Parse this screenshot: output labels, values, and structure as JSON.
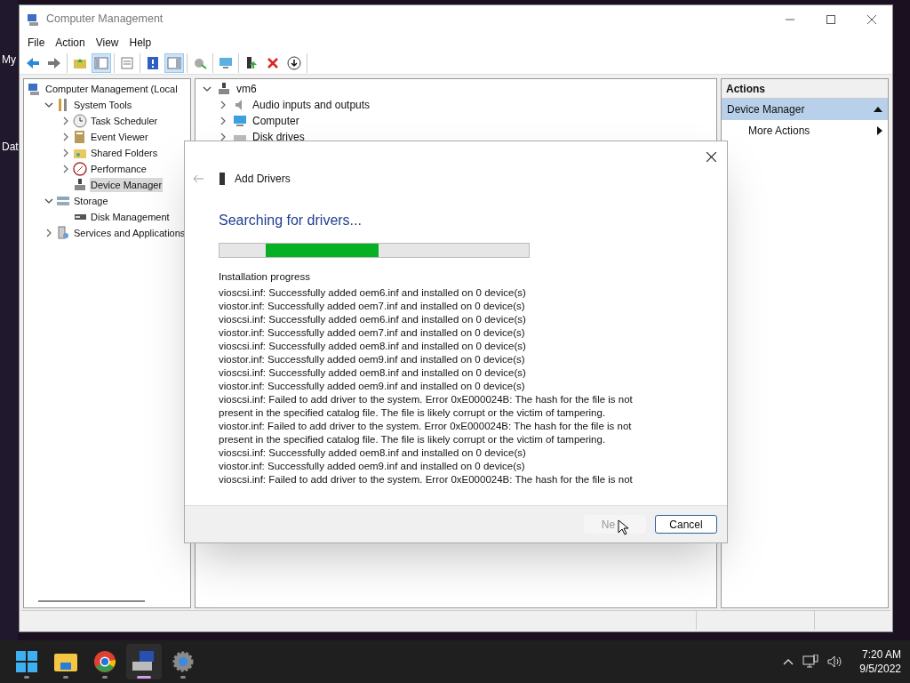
{
  "desktop_labels": [
    "My",
    "Dat"
  ],
  "window": {
    "title": "Computer Management"
  },
  "menu": [
    "File",
    "Action",
    "View",
    "Help"
  ],
  "toolbar": [
    {
      "pressed": false
    },
    {
      "pressed": false
    },
    {
      "pressed": false
    },
    {
      "pressed": true
    },
    {
      "pressed": false
    },
    {
      "pressed": false
    },
    {
      "pressed": true
    },
    {
      "pressed": false
    },
    {
      "pressed": false
    },
    {
      "pressed": false
    },
    {
      "pressed": false
    },
    {
      "pressed": false
    }
  ],
  "tree": [
    {
      "label": "Computer Management (Local",
      "kind": "root",
      "selected": false,
      "children": [
        {
          "label": "System Tools",
          "kind": "node",
          "expanded": true,
          "selected": false,
          "children": [
            {
              "label": "Task Scheduler",
              "kind": "node",
              "expanded": false,
              "selected": false
            },
            {
              "label": "Event Viewer",
              "kind": "node",
              "expanded": false,
              "selected": false
            },
            {
              "label": "Shared Folders",
              "kind": "node",
              "expanded": false,
              "selected": false
            },
            {
              "label": "Performance",
              "kind": "node",
              "expanded": false,
              "selected": false
            },
            {
              "label": "Device Manager",
              "kind": "leaf",
              "selected": true
            }
          ]
        },
        {
          "label": "Storage",
          "kind": "node",
          "expanded": true,
          "selected": false,
          "children": [
            {
              "label": "Disk Management",
              "kind": "leaf",
              "selected": false
            }
          ]
        },
        {
          "label": "Services and Applications",
          "kind": "node",
          "expanded": false,
          "selected": false
        }
      ]
    }
  ],
  "devices": [
    {
      "label": "vm6",
      "kind": "node",
      "expanded": true,
      "children": [
        {
          "label": "Audio inputs and outputs",
          "kind": "node",
          "expanded": false
        },
        {
          "label": "Computer",
          "kind": "node",
          "expanded": false
        },
        {
          "label": "Disk drives",
          "kind": "node",
          "expanded": false
        }
      ]
    }
  ],
  "actions": {
    "title": "Actions",
    "section": "Device Manager",
    "items": [
      "More Actions"
    ]
  },
  "dialog": {
    "title": "Add Drivers",
    "heading": "Searching for drivers...",
    "progress": {
      "indeterminate": true
    },
    "log_label": "Installation progress",
    "log_lines": [
      "vioscsi.inf: Successfully added oem6.inf and installed on 0 device(s)",
      "viostor.inf: Successfully added oem7.inf and installed on 0 device(s)",
      "vioscsi.inf: Successfully added oem6.inf and installed on 0 device(s)",
      "viostor.inf: Successfully added oem7.inf and installed on 0 device(s)",
      "vioscsi.inf: Successfully added oem8.inf and installed on 0 device(s)",
      "viostor.inf: Successfully added oem9.inf and installed on 0 device(s)",
      "vioscsi.inf: Successfully added oem8.inf and installed on 0 device(s)",
      "viostor.inf: Successfully added oem9.inf and installed on 0 device(s)",
      "vioscsi.inf: Failed to add driver to the system. Error 0xE000024B: The hash for the file is not",
      "present in the specified catalog file. The file is likely corrupt or the victim of tampering.",
      "viostor.inf: Failed to add driver to the system. Error 0xE000024B: The hash for the file is not",
      "present in the specified catalog file. The file is likely corrupt or the victim of tampering.",
      "vioscsi.inf: Successfully added oem8.inf and installed on 0 device(s)",
      "viostor.inf: Successfully added oem9.inf and installed on 0 device(s)",
      "vioscsi.inf: Failed to add driver to the system. Error 0xE000024B: The hash for the file is not"
    ],
    "buttons": [
      {
        "label": "Ne",
        "disabled": true
      },
      {
        "label": "Cancel",
        "disabled": false
      }
    ]
  },
  "taskbar": {
    "apps": [
      {
        "active": false
      },
      {
        "active": false
      },
      {
        "active": false
      },
      {
        "active": true
      },
      {
        "active": false
      }
    ],
    "time": "7:20 AM",
    "date": "9/5/2022"
  }
}
